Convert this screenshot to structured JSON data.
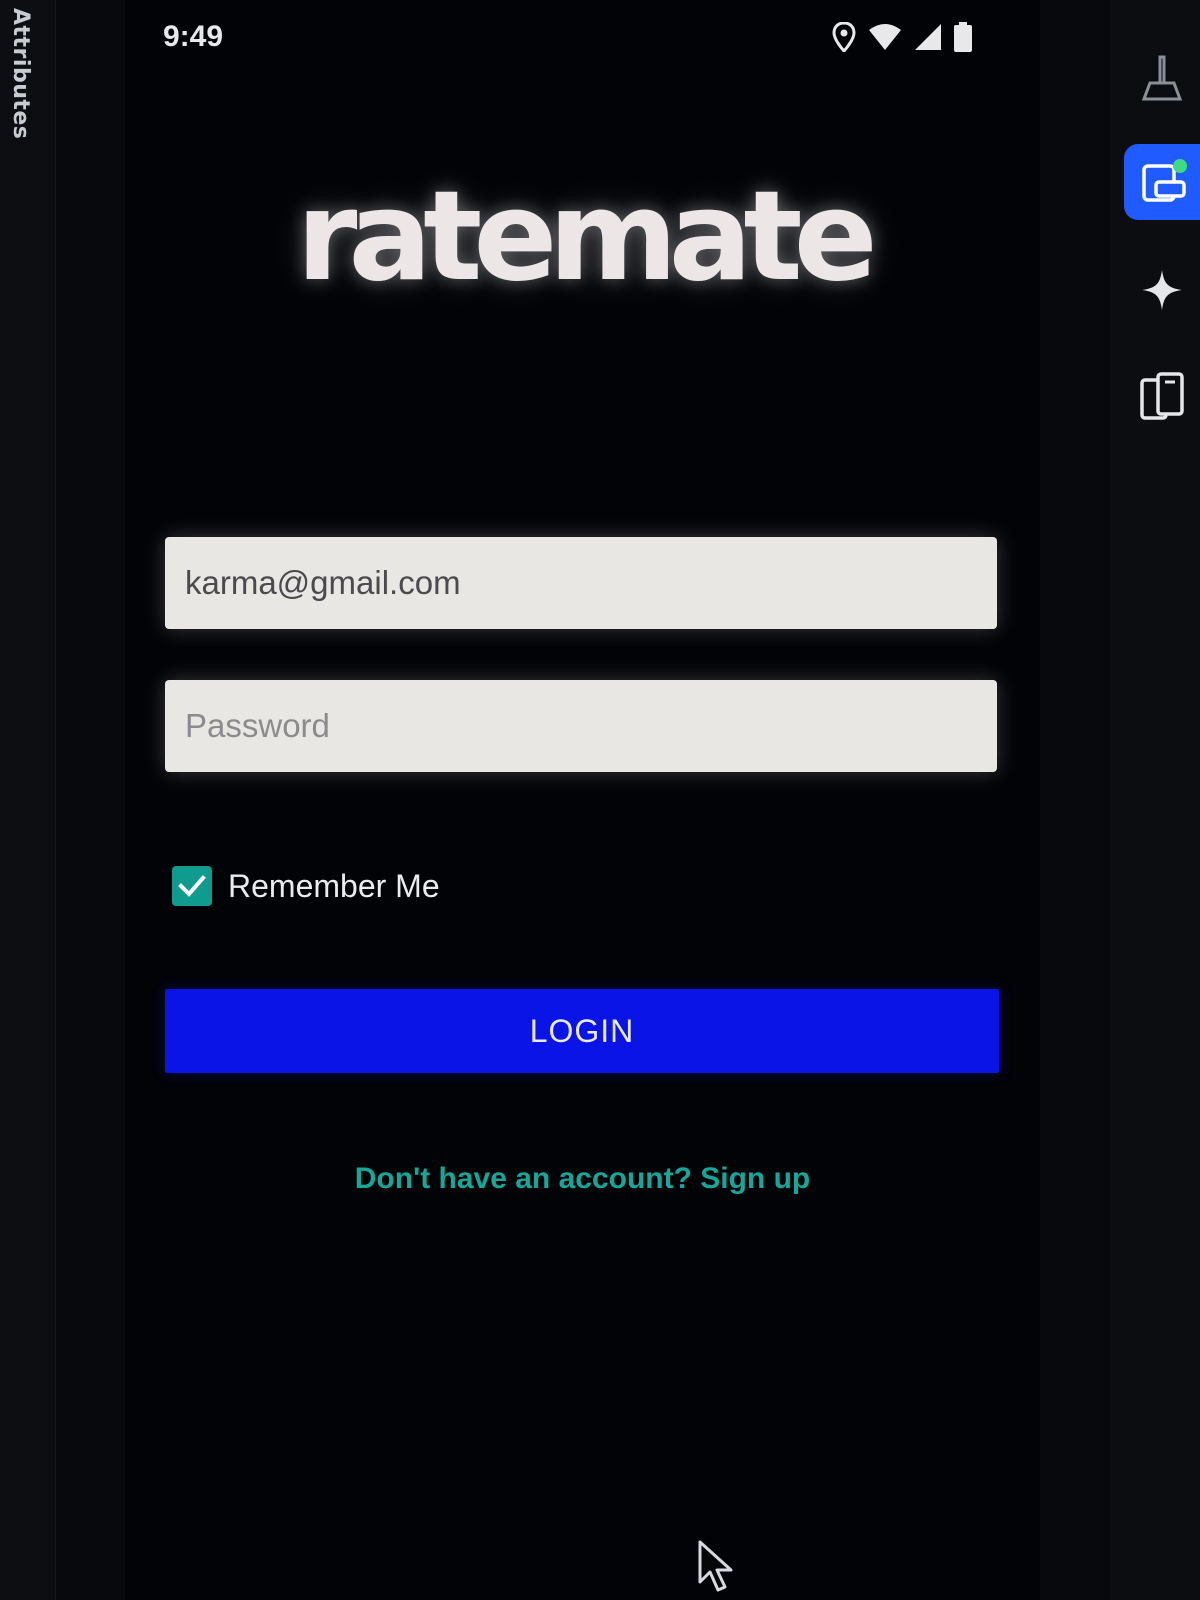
{
  "ide": {
    "attributes_label": "Attributes",
    "right_toolbar": [
      {
        "icon": "brush-icon"
      },
      {
        "icon": "device-manager-icon",
        "active": true
      },
      {
        "icon": "gemini-sparkle-icon"
      },
      {
        "icon": "device-mirror-icon"
      }
    ]
  },
  "status_bar": {
    "time": "9:49",
    "icons": [
      "location-icon",
      "wifi-icon",
      "signal-icon",
      "battery-icon"
    ]
  },
  "app": {
    "logo_text": "ratemate",
    "email": {
      "value": "karma@gmail.com"
    },
    "password": {
      "placeholder": "Password"
    },
    "remember_me": {
      "label": "Remember Me",
      "checked": true
    },
    "login_button": "LOGIN",
    "signup_link": "Don't have an account? Sign up"
  },
  "colors": {
    "background": "#020307",
    "accent_teal": "#0f9b8e",
    "login_blue": "#0b14e6",
    "link_teal": "#14a89a",
    "field_bg": "#e9e7e4"
  }
}
